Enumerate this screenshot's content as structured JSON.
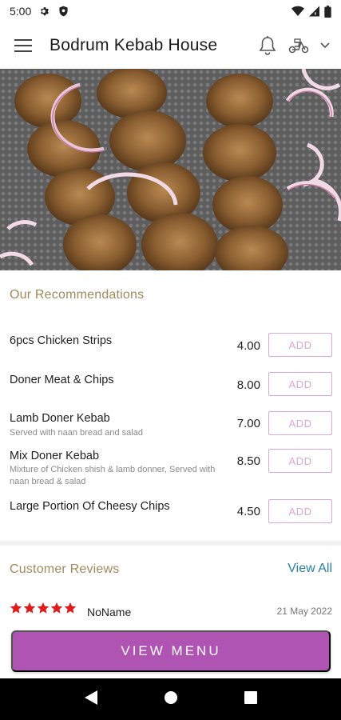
{
  "status_bar": {
    "time": "5:00",
    "left_icons": [
      "gear-icon",
      "shield-icon"
    ],
    "right_icons": [
      "wifi-icon",
      "signal-icon",
      "battery-icon"
    ]
  },
  "app_bar": {
    "title": "Bodrum Kebab House",
    "menu_icon": "hamburger-menu-icon",
    "notification_icon": "bell-icon",
    "order_type_icon": "scooter-icon",
    "dropdown_icon": "chevron-down-icon"
  },
  "hero": {
    "image": "grilled-chicken-skewers-photo"
  },
  "recommendations": {
    "title": "Our Recommendations",
    "add_label": "ADD",
    "items": [
      {
        "name": "6pcs Chicken Strips",
        "description": "",
        "price": "4.00"
      },
      {
        "name": "Doner Meat & Chips",
        "description": "",
        "price": "8.00"
      },
      {
        "name": "Lamb Doner Kebab",
        "description": "Served with naan bread and salad",
        "price": "7.00"
      },
      {
        "name": "Mix Doner Kebab",
        "description": "Mixture of Chicken shish & lamb donner, Served with naan bread & salad",
        "price": "8.50"
      },
      {
        "name": "Large Portion Of Cheesy Chips",
        "description": "",
        "price": "4.50"
      }
    ]
  },
  "reviews": {
    "title": "Customer Reviews",
    "view_all_label": "View All",
    "items": [
      {
        "rating": 5,
        "reviewer": "NoName",
        "date": "21 May 2022"
      }
    ]
  },
  "view_menu_label": "VIEW MENU",
  "colors": {
    "accent": "#b054b4",
    "add_button": "#d9a8d8",
    "section_title": "#a08a5c",
    "link": "#2a7fa6",
    "star": "#e01b1b"
  },
  "nav_bar": {
    "icons": [
      "back-icon",
      "home-icon",
      "recents-icon"
    ]
  }
}
